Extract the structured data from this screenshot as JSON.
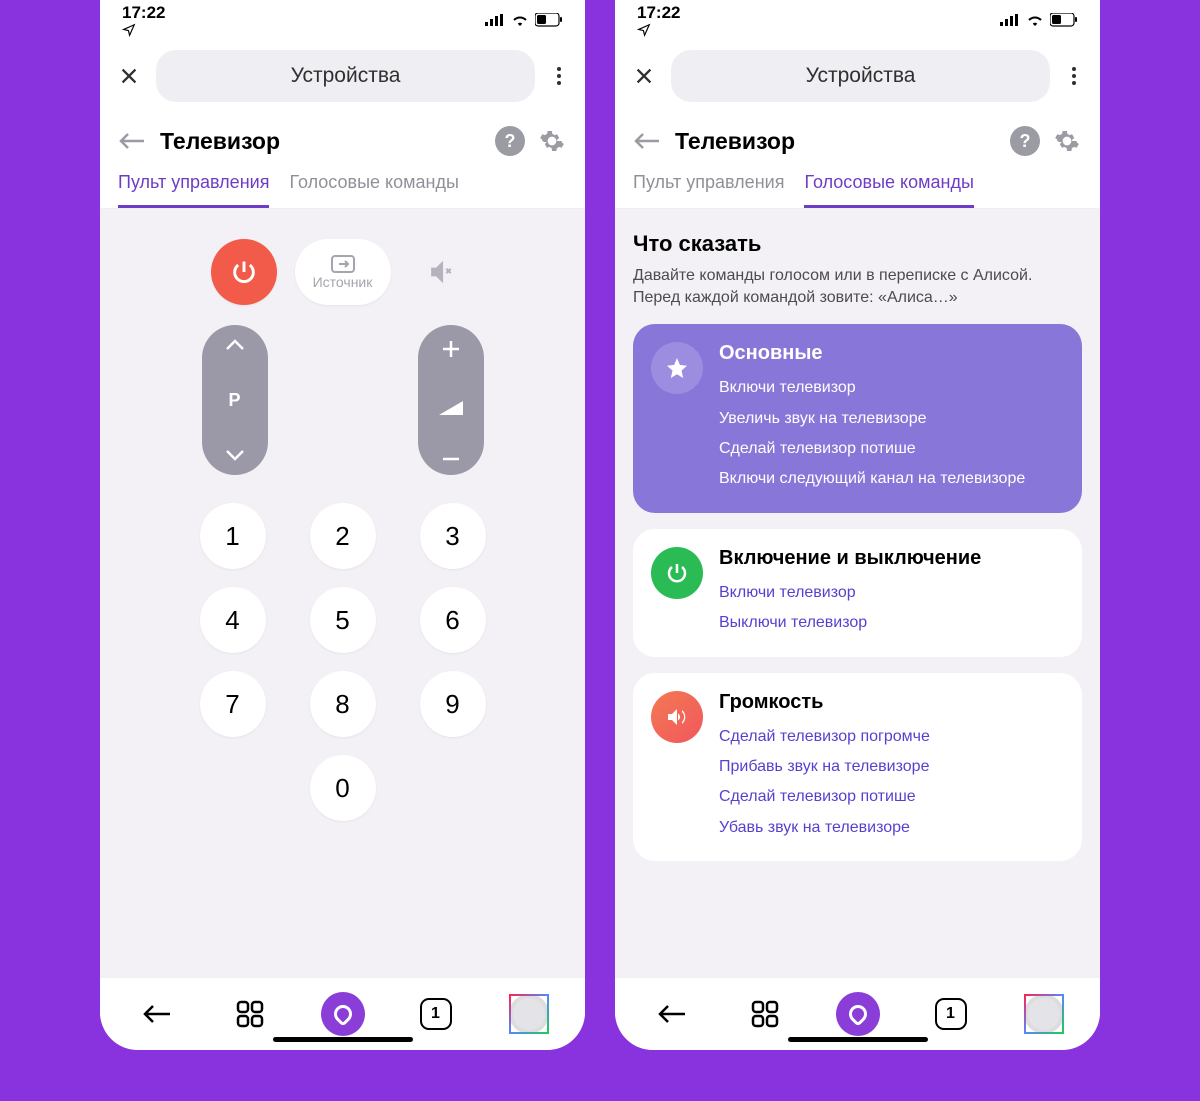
{
  "status": {
    "time": "17:22"
  },
  "top": {
    "chip": "Устройства"
  },
  "header": {
    "title": "Телевизор"
  },
  "tabs": {
    "remote": "Пульт управления",
    "voice": "Голосовые команды"
  },
  "remote": {
    "source": "Источник",
    "channel_label": "P",
    "keys": [
      "1",
      "2",
      "3",
      "4",
      "5",
      "6",
      "7",
      "8",
      "9",
      "0"
    ]
  },
  "voice": {
    "heading": "Что сказать",
    "desc": "Давайте команды голосом или в переписке с Алисой. Перед каждой командой зовите: «Алиса…»",
    "cards": [
      {
        "title": "Основные",
        "items": [
          "Включи телевизор",
          "Увеличь звук на телевизоре",
          "Сделай телевизор потише",
          "Включи следующий канал на телевизоре"
        ]
      },
      {
        "title": "Включение и выключение",
        "items": [
          "Включи телевизор",
          "Выключи телевизор"
        ]
      },
      {
        "title": "Громкость",
        "items": [
          "Сделай телевизор погромче",
          "Прибавь звук на телевизоре",
          "Сделай телевизор потише",
          "Убавь звук на телевизоре"
        ]
      }
    ]
  },
  "nav": {
    "tab_count": "1"
  }
}
